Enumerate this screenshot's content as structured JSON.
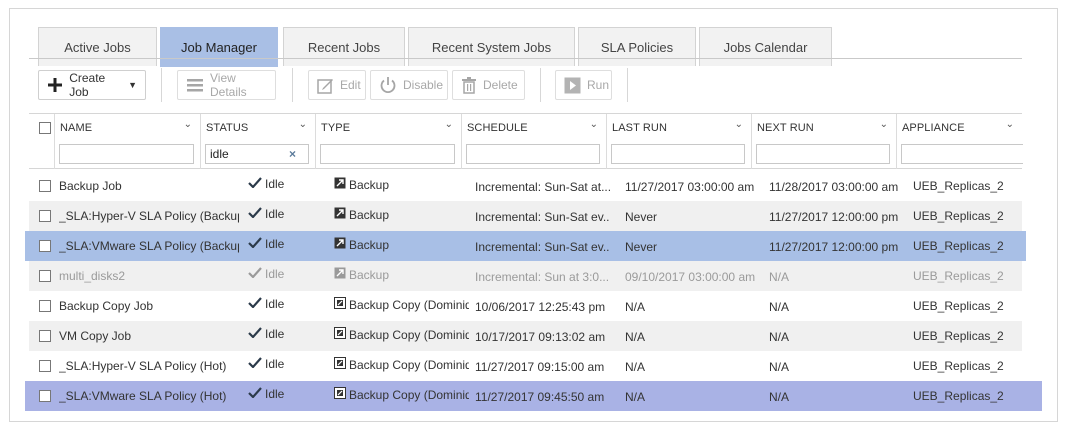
{
  "tabs": [
    {
      "label": "Active Jobs"
    },
    {
      "label": "Job Manager"
    },
    {
      "label": "Recent Jobs"
    },
    {
      "label": "Recent System Jobs"
    },
    {
      "label": "SLA Policies"
    },
    {
      "label": "Jobs Calendar"
    }
  ],
  "active_tab": "Job Manager",
  "toolbar": {
    "create_job": "Create Job",
    "view_details": "View Details",
    "edit": "Edit",
    "disable": "Disable",
    "delete": "Delete",
    "run": "Run"
  },
  "columns": [
    {
      "label": "NAME",
      "filter": ""
    },
    {
      "label": "STATUS",
      "filter": "idle"
    },
    {
      "label": "TYPE",
      "filter": ""
    },
    {
      "label": "SCHEDULE",
      "filter": ""
    },
    {
      "label": "LAST RUN",
      "filter": ""
    },
    {
      "label": "NEXT RUN",
      "filter": ""
    },
    {
      "label": "APPLIANCE",
      "filter": ""
    }
  ],
  "rows": [
    {
      "name": "Backup Job",
      "status": "Idle",
      "type": "Backup",
      "schedule": "Incremental: Sun-Sat at...",
      "last_run": "11/27/2017 03:00:00 am",
      "next_run": "11/28/2017 03:00:00 am",
      "appliance": "UEB_Replicas_2",
      "state": "normal"
    },
    {
      "name": "_SLA:Hyper-V SLA Policy (Backup)",
      "status": "Idle",
      "type": "Backup",
      "schedule": "Incremental: Sun-Sat ev...",
      "last_run": "Never",
      "next_run": "11/27/2017 12:00:00 pm",
      "appliance": "UEB_Replicas_2",
      "state": "alt"
    },
    {
      "name": "_SLA:VMware SLA Policy (Backup)",
      "status": "Idle",
      "type": "Backup",
      "schedule": "Incremental: Sun-Sat ev...",
      "last_run": "Never",
      "next_run": "11/27/2017 12:00:00 pm",
      "appliance": "UEB_Replicas_2",
      "state": "selected"
    },
    {
      "name": "multi_disks2",
      "status": "Idle",
      "type": "Backup",
      "schedule": "Incremental: Sun at 3:0...",
      "last_run": "09/10/2017 03:00:00 am",
      "next_run": "N/A",
      "appliance": "UEB_Replicas_2",
      "state": "disabled"
    },
    {
      "name": "Backup Copy Job",
      "status": "Idle",
      "type": "Backup Copy (Dominique...",
      "schedule": "10/06/2017 12:25:43 pm",
      "last_run": "N/A",
      "next_run": "N/A",
      "appliance": "UEB_Replicas_2",
      "state": "normal"
    },
    {
      "name": "VM Copy Job",
      "status": "Idle",
      "type": "Backup Copy (Dominique...",
      "schedule": "10/17/2017 09:13:02 am",
      "last_run": "N/A",
      "next_run": "N/A",
      "appliance": "UEB_Replicas_2",
      "state": "alt"
    },
    {
      "name": "_SLA:Hyper-V SLA Policy (Hot)",
      "status": "Idle",
      "type": "Backup Copy (Dominique...",
      "schedule": "11/27/2017 09:15:00 am",
      "last_run": "N/A",
      "next_run": "N/A",
      "appliance": "UEB_Replicas_2",
      "state": "normal"
    },
    {
      "name": "_SLA:VMware SLA Policy (Hot)",
      "status": "Idle",
      "type": "Backup Copy (Dominique...",
      "schedule": "11/27/2017 09:45:50 am",
      "last_run": "N/A",
      "next_run": "N/A",
      "appliance": "UEB_Replicas_2",
      "state": "selected2"
    }
  ],
  "colors": {
    "active_tab": "#a9bfe5",
    "selected_row": "#a8bfe6",
    "selected_row_2": "#a9b2e5",
    "alt_row": "#f0f0f0"
  }
}
